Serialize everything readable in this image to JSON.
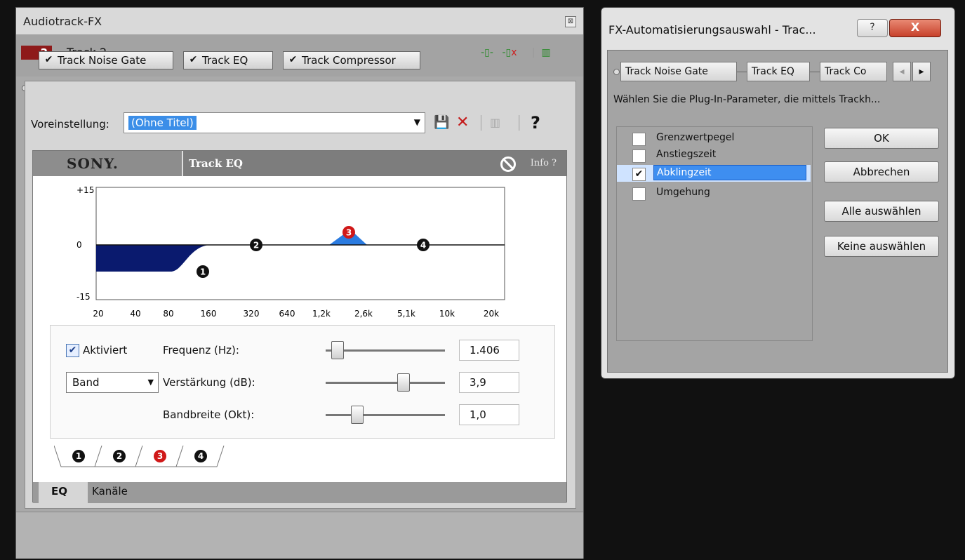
{
  "fx_window": {
    "title": "Audiotrack-FX",
    "close_glyph": "⊠",
    "track_number": "2",
    "track_name": "Track 2",
    "plugins": [
      {
        "label": "Track Noise Gate",
        "checked": true
      },
      {
        "label": "Track EQ",
        "checked": true
      },
      {
        "label": "Track Compressor",
        "checked": true
      }
    ],
    "preset_label": "Voreinstellung:",
    "preset_value": "(Ohne Titel)",
    "help_glyph": "?",
    "plugin_header": {
      "brand": "SONY.",
      "title": "Track EQ",
      "info": "Info ?"
    },
    "eq_chart": {
      "y_ticks": [
        "+15",
        "0",
        "-15"
      ],
      "x_ticks": [
        "20",
        "40",
        "80",
        "160",
        "320",
        "640",
        "1,2k",
        "2,6k",
        "5,1k",
        "10k",
        "20k"
      ],
      "band_markers": [
        "1",
        "2",
        "3",
        "4"
      ],
      "selected_band": "3"
    },
    "controls": {
      "enabled_label": "Aktiviert",
      "enabled": true,
      "type_value": "Band",
      "frequency_label": "Frequenz (Hz):",
      "frequency_value": "1.406",
      "gain_label": "Verstärkung (dB):",
      "gain_value": "3,9",
      "bandwidth_label": "Bandbreite (Okt):",
      "bandwidth_value": "1,0"
    },
    "band_tabs": [
      "1",
      "2",
      "3",
      "4"
    ],
    "bottom_tabs": [
      "EQ",
      "Kanäle"
    ]
  },
  "dialog": {
    "title": "FX-Automatisierungsauswahl - Trac...",
    "help_glyph": "?",
    "close_glyph": "X",
    "tabs": [
      "Track Noise Gate",
      "Track EQ",
      "Track Co"
    ],
    "description": "Wählen Sie die Plug-In-Parameter, die mittels Trackh...",
    "parameters": [
      {
        "label": "Grenzwertpegel",
        "checked": false
      },
      {
        "label": "Anstiegszeit",
        "checked": false
      },
      {
        "label": "Abklingzeit",
        "checked": true
      },
      {
        "label": "Umgehung",
        "checked": false
      }
    ],
    "buttons": {
      "ok": "OK",
      "cancel": "Abbrechen",
      "select_all": "Alle auswählen",
      "select_none": "Keine auswählen"
    }
  },
  "colors": {
    "accent_selection": "#3e8ef0",
    "track_badge": "#8e1a1a",
    "eq_low_shelf": "#0a1a6e",
    "eq_band3": "#2a7be0",
    "selected_band": "#d01818"
  }
}
